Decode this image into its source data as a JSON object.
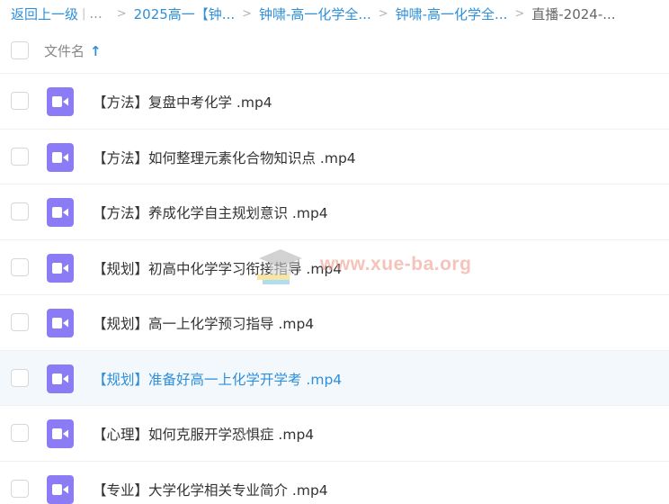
{
  "breadcrumb": {
    "back": "返回上一级",
    "ellipsis": "...",
    "crumb1": "2025高一【钟...",
    "crumb2": "钟啸-高一化学全...",
    "crumb3": "钟啸-高一化学全...",
    "current": "直播-2024-..."
  },
  "header": {
    "name_column": "文件名",
    "sort_icon": "arrow-up-icon"
  },
  "files": [
    {
      "name": "【方法】复盘中考化学 .mp4",
      "icon": "video-file-icon"
    },
    {
      "name": "【方法】如何整理元素化合物知识点 .mp4",
      "icon": "video-file-icon"
    },
    {
      "name": "【方法】养成化学自主规划意识 .mp4",
      "icon": "video-file-icon"
    },
    {
      "name": "【规划】初高中化学学习衔接指导 .mp4",
      "icon": "video-file-icon"
    },
    {
      "name": "【规划】高一上化学预习指导 .mp4",
      "icon": "video-file-icon"
    },
    {
      "name": "【规划】准备好高一上化学开学考 .mp4",
      "icon": "video-file-icon",
      "highlighted": true
    },
    {
      "name": "【心理】如何克服开学恐惧症 .mp4",
      "icon": "video-file-icon"
    },
    {
      "name": "【专业】大学化学相关专业简介 .mp4",
      "icon": "video-file-icon"
    }
  ],
  "watermark": {
    "text": "www.xue-ba.org"
  },
  "colors": {
    "accent": "#2f8fd8",
    "file_icon": "#8b7cf6",
    "highlight_row": "#f3f8fd"
  }
}
